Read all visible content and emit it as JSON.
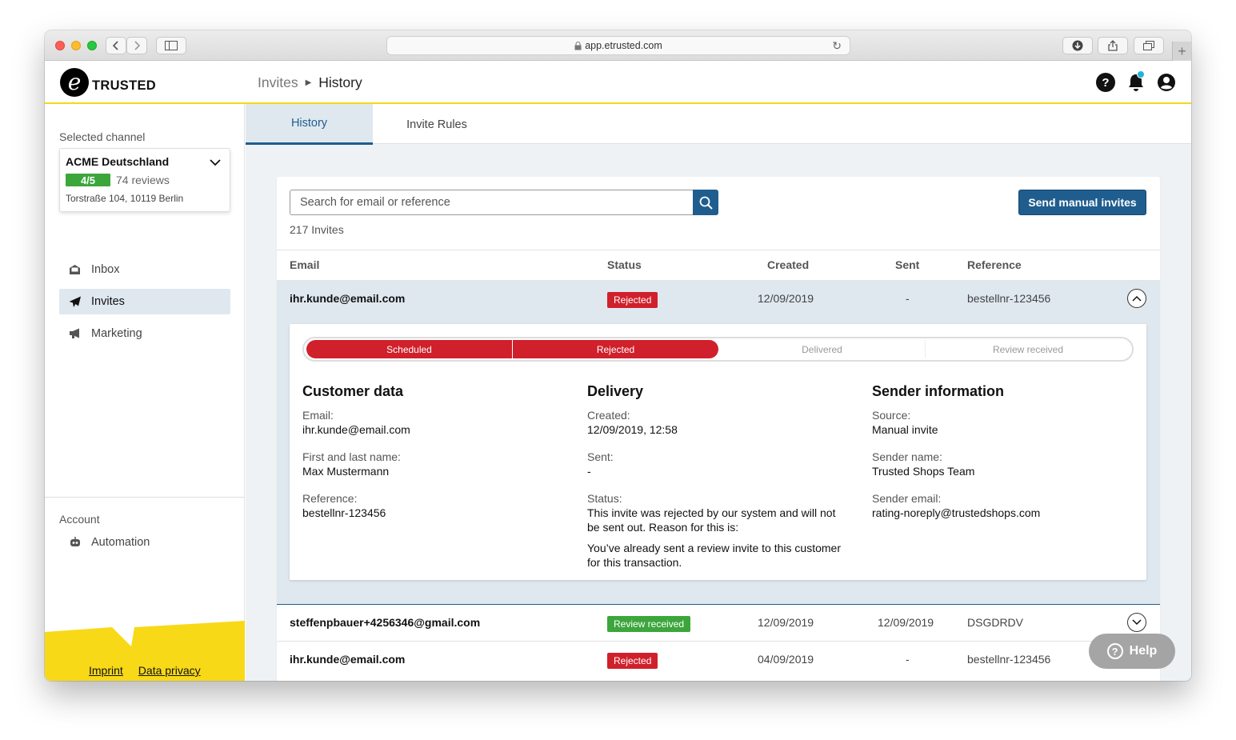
{
  "browser": {
    "url": "app.etrusted.com"
  },
  "header": {
    "logo_letter": "e",
    "logo_text": "TRUSTED",
    "breadcrumb": [
      "Invites",
      "History"
    ],
    "help_icon": "?"
  },
  "sidebar": {
    "selected_channel_label": "Selected channel",
    "channel": {
      "name": "ACME Deutschland",
      "rating": "4/5",
      "reviews": "74 reviews",
      "address": "Torstraße 104, 10119 Berlin"
    },
    "nav": [
      {
        "label": "Inbox",
        "icon": "inbox-icon"
      },
      {
        "label": "Invites",
        "icon": "paper-plane-icon"
      },
      {
        "label": "Marketing",
        "icon": "megaphone-icon"
      }
    ],
    "account_label": "Account",
    "account_nav": [
      {
        "label": "Automation",
        "icon": "robot-icon"
      }
    ],
    "footer_links": [
      "Imprint",
      "Data privacy"
    ]
  },
  "tabs": [
    "History",
    "Invite Rules"
  ],
  "toolbar": {
    "search_placeholder": "Search for email or reference",
    "send_button": "Send manual invites",
    "count": "217 Invites"
  },
  "table": {
    "columns": [
      "Email",
      "Status",
      "Created",
      "Sent",
      "Reference"
    ],
    "rows": [
      {
        "email": "ihr.kunde@email.com",
        "status": "Rejected",
        "created": "12/09/2019",
        "sent": "-",
        "reference": "bestellnr-123456"
      },
      {
        "email": "steffenpbauer+4256346@gmail.com",
        "status": "Review received",
        "created": "12/09/2019",
        "sent": "12/09/2019",
        "reference": "DSGDRDV"
      },
      {
        "email": "ihr.kunde@email.com",
        "status": "Rejected",
        "created": "04/09/2019",
        "sent": "-",
        "reference": "bestellnr-123456"
      }
    ]
  },
  "detail": {
    "progress_steps": [
      "Scheduled",
      "Rejected",
      "Delivered",
      "Review received"
    ],
    "customer": {
      "title": "Customer data",
      "email_label": "Email:",
      "email": "ihr.kunde@email.com",
      "name_label": "First and last name:",
      "name": "Max Mustermann",
      "reference_label": "Reference:",
      "reference": "bestellnr-123456"
    },
    "delivery": {
      "title": "Delivery",
      "created_label": "Created:",
      "created": "12/09/2019, 12:58",
      "sent_label": "Sent:",
      "sent": "-",
      "status_label": "Status:",
      "status_text": "This invite was rejected by our system and will not be sent out. Reason for this is:",
      "status_reason": "You’ve already sent a review invite to this customer for this transaction."
    },
    "sender": {
      "title": "Sender information",
      "source_label": "Source:",
      "source": "Manual invite",
      "name_label": "Sender name:",
      "name": "Trusted Shops Team",
      "email_label": "Sender email:",
      "email": "rating-noreply@trustedshops.com"
    }
  },
  "help_button": "Help",
  "colors": {
    "brand_blue": "#1f5d8e",
    "brand_yellow": "#f5d817",
    "rejected": "#d0202b",
    "success": "#3ca63c"
  }
}
